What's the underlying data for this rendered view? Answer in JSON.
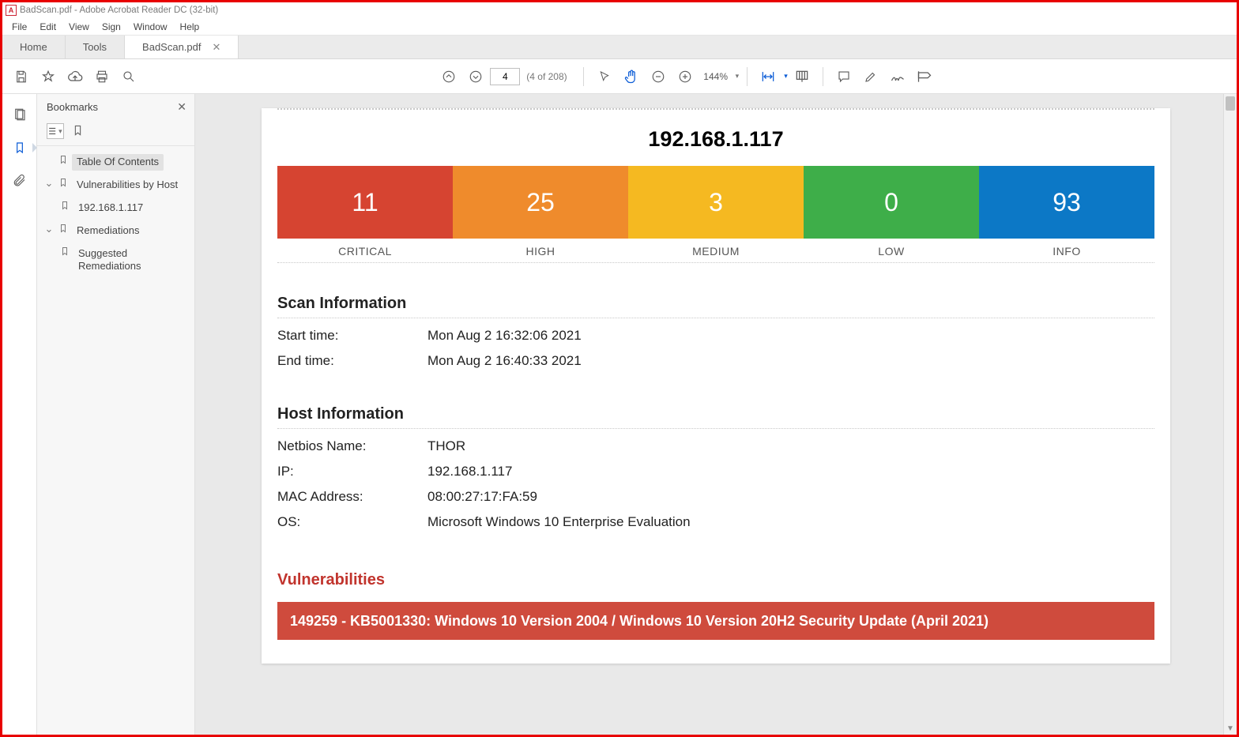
{
  "window": {
    "title": "BadScan.pdf - Adobe Acrobat Reader DC (32-bit)"
  },
  "menu": [
    "File",
    "Edit",
    "View",
    "Sign",
    "Window",
    "Help"
  ],
  "tabs": {
    "home": "Home",
    "tools": "Tools",
    "doc": "BadScan.pdf"
  },
  "toolbar": {
    "page_value": "4",
    "page_count_label": "(4 of 208)",
    "zoom_label": "144%"
  },
  "bookmarks": {
    "title": "Bookmarks",
    "items": {
      "toc": "Table Of Contents",
      "byhost": "Vulnerabilities by Host",
      "host1": "192.168.1.117",
      "remed": "Remediations",
      "sug": "Suggested Remediations"
    }
  },
  "doc": {
    "ip_title": "192.168.1.117",
    "sev": {
      "critical": {
        "count": "11",
        "label": "CRITICAL",
        "color": "#d64431"
      },
      "high": {
        "count": "25",
        "label": "HIGH",
        "color": "#ef8b2c"
      },
      "medium": {
        "count": "3",
        "label": "MEDIUM",
        "color": "#f5b921"
      },
      "low": {
        "count": "0",
        "label": "LOW",
        "color": "#3eae49"
      },
      "info": {
        "count": "93",
        "label": "INFO",
        "color": "#0c78c6"
      }
    },
    "scan": {
      "heading": "Scan Information",
      "start_k": "Start time:",
      "start_v": "Mon Aug 2 16:32:06 2021",
      "end_k": "End time:",
      "end_v": "Mon Aug 2 16:40:33 2021"
    },
    "host": {
      "heading": "Host Information",
      "netbios_k": "Netbios Name:",
      "netbios_v": "THOR",
      "ip_k": "IP:",
      "ip_v": "192.168.1.117",
      "mac_k": "MAC Address:",
      "mac_v": "08:00:27:17:FA:59",
      "os_k": "OS:",
      "os_v": "Microsoft Windows 10 Enterprise Evaluation"
    },
    "vuln": {
      "heading": "Vulnerabilities",
      "first_bar": "149259 - KB5001330: Windows 10 Version 2004 / Windows 10 Version 20H2 Security Update (April 2021)"
    }
  }
}
